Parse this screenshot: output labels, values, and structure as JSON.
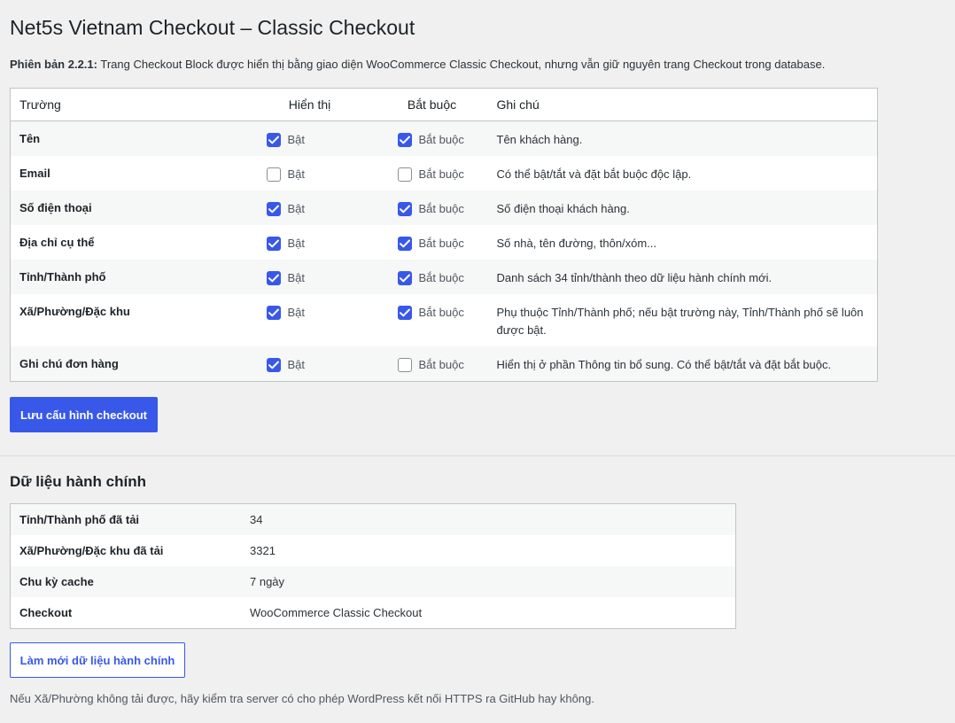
{
  "page": {
    "title": "Net5s Vietnam Checkout – Classic Checkout",
    "version_label": "Phiên bản 2.2.1:",
    "version_text": " Trang Checkout Block được hiển thị bằng giao diện WooCommerce Classic Checkout, nhưng vẫn giữ nguyên trang Checkout trong database."
  },
  "fields_table": {
    "headers": {
      "field": "Trường",
      "visible": "Hiển thị",
      "required": "Bắt buộc",
      "note": "Ghi chú"
    },
    "rows": [
      {
        "label": "Tên",
        "visible": true,
        "visible_label": "Bật",
        "required": true,
        "required_label": "Bắt buộc",
        "note": "Tên khách hàng."
      },
      {
        "label": "Email",
        "visible": false,
        "visible_label": "Bật",
        "required": false,
        "required_label": "Bắt buộc",
        "note": "Có thể bật/tắt và đặt bắt buộc độc lập."
      },
      {
        "label": "Số điện thoại",
        "visible": true,
        "visible_label": "Bật",
        "required": true,
        "required_label": "Bắt buộc",
        "note": "Số điện thoại khách hàng."
      },
      {
        "label": "Địa chỉ cụ thể",
        "visible": true,
        "visible_label": "Bật",
        "required": true,
        "required_label": "Bắt buộc",
        "note": "Số nhà, tên đường, thôn/xóm..."
      },
      {
        "label": "Tỉnh/Thành phố",
        "visible": true,
        "visible_label": "Bật",
        "required": true,
        "required_label": "Bắt buộc",
        "note": "Danh sách 34 tỉnh/thành theo dữ liệu hành chính mới."
      },
      {
        "label": "Xã/Phường/Đặc khu",
        "visible": true,
        "visible_label": "Bật",
        "required": true,
        "required_label": "Bắt buộc",
        "note": "Phụ thuộc Tỉnh/Thành phố; nếu bật trường này, Tỉnh/Thành phố sẽ luôn được bật."
      },
      {
        "label": "Ghi chú đơn hàng",
        "visible": true,
        "visible_label": "Bật",
        "required": false,
        "required_label": "Bắt buộc",
        "note": "Hiển thị ở phần Thông tin bổ sung. Có thể bật/tắt và đặt bắt buộc."
      }
    ]
  },
  "save_button": "Lưu cấu hình checkout",
  "admin_section": {
    "heading": "Dữ liệu hành chính",
    "rows": [
      {
        "key": "Tỉnh/Thành phố đã tải",
        "value": "34"
      },
      {
        "key": "Xã/Phường/Đặc khu đã tải",
        "value": "3321"
      },
      {
        "key": "Chu kỳ cache",
        "value": "7 ngày"
      },
      {
        "key": "Checkout",
        "value": "WooCommerce Classic Checkout"
      }
    ],
    "refresh_button": "Làm mới dữ liệu hành chính",
    "footnote": "Nếu Xã/Phường không tải được, hãy kiểm tra server có cho phép WordPress kết nối HTTPS ra GitHub hay không."
  },
  "colors": {
    "accent": "#3858e9",
    "background": "#f0f0f1",
    "row_alt": "#f6f7f7",
    "border": "#c3c4c7"
  }
}
